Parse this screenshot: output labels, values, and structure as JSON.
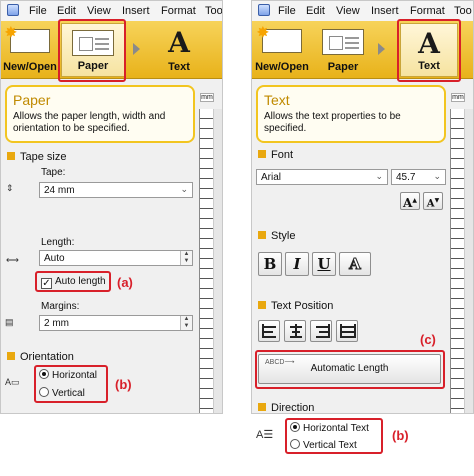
{
  "left": {
    "menu": [
      "File",
      "Edit",
      "View",
      "Insert",
      "Format",
      "Too"
    ],
    "ribbon": [
      {
        "label": "New/Open",
        "icon": "new-open-icon"
      },
      {
        "label": "Paper",
        "icon": "paper-icon",
        "selected": true
      },
      {
        "label": "Text",
        "icon": "text-icon"
      }
    ],
    "info_title": "Paper",
    "info_desc": "Allows the paper length, width and orientation to be specified.",
    "tape_size_header": "Tape size",
    "tape_label": "Tape:",
    "tape_value": "24 mm",
    "length_label": "Length:",
    "length_value": "Auto",
    "auto_length_label": "Auto length",
    "auto_length_checked": true,
    "anno_a": "(a)",
    "margins_label": "Margins:",
    "margins_value": "2 mm",
    "orientation_header": "Orientation",
    "opt_horizontal": "Horizontal",
    "opt_vertical": "Vertical",
    "anno_b": "(b)",
    "ruler_unit": "mm"
  },
  "right": {
    "menu": [
      "File",
      "Edit",
      "View",
      "Insert",
      "Format",
      "Too"
    ],
    "ribbon": [
      {
        "label": "New/Open",
        "icon": "new-open-icon"
      },
      {
        "label": "Paper",
        "icon": "paper-icon"
      },
      {
        "label": "Text",
        "icon": "text-icon",
        "selected": true
      }
    ],
    "info_title": "Text",
    "info_desc": "Allows the text properties to be specified.",
    "font_header": "Font",
    "font_value": "Arial",
    "size_value": "45.7",
    "style_header": "Style",
    "style_buttons": [
      "B",
      "I",
      "U",
      "A"
    ],
    "text_position_header": "Text Position",
    "anno_c": "(c)",
    "auto_length_button": "Automatic Length",
    "direction_header": "Direction",
    "opt_horizontal_text": "Horizontal Text",
    "opt_vertical_text": "Vertical Text",
    "anno_b": "(b)",
    "ruler_unit": "mm"
  },
  "colors": {
    "annotation": "#d8202a",
    "ribbon": "#f2c520",
    "section_square": "#e9a80f"
  }
}
